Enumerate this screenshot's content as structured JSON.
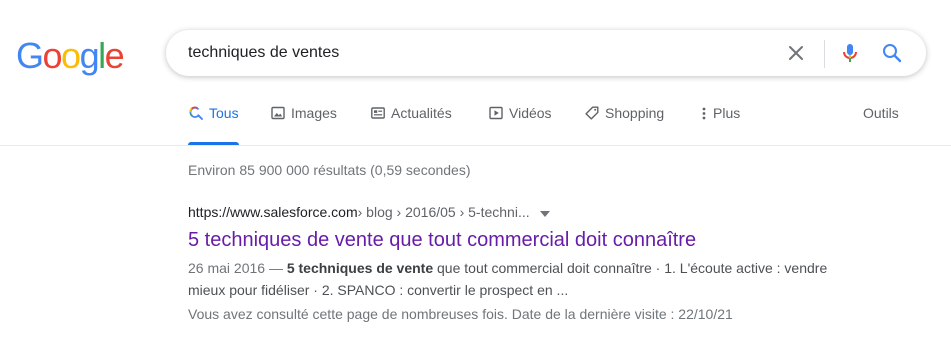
{
  "logo": {
    "letters": [
      "G",
      "o",
      "o",
      "g",
      "l",
      "e"
    ],
    "colors": [
      "#4285F4",
      "#EA4335",
      "#FBBC05",
      "#4285F4",
      "#34A853",
      "#EA4335"
    ]
  },
  "search": {
    "query": "techniques de ventes"
  },
  "tabs": [
    {
      "label": "Tous",
      "icon": "search-icon",
      "active": true
    },
    {
      "label": "Images",
      "icon": "image-icon"
    },
    {
      "label": "Actualités",
      "icon": "news-icon"
    },
    {
      "label": "Vidéos",
      "icon": "video-icon"
    },
    {
      "label": "Shopping",
      "icon": "tag-icon"
    },
    {
      "label": "Plus",
      "icon": "more-vertical-icon"
    }
  ],
  "tools_label": "Outils",
  "stats": "Environ 85 900 000 résultats (0,59 secondes)",
  "result": {
    "url_host": "https://www.salesforce.com",
    "url_crumbs": " › blog › 2016/05 › 5-techni...",
    "title": "5 techniques de vente que tout commercial doit connaître",
    "date": "26 mai 2016 — ",
    "snippet_bold": "5 techniques de vente",
    "snippet_rest": " que tout commercial doit connaître · 1. L'écoute active : vendre mieux pour fidéliser · 2. SPANCO : convertir le prospect en ...",
    "visited": "Vous avez consulté cette page de nombreuses fois. Date de la dernière visite : 22/10/21"
  },
  "colors": {
    "link_visited": "#681da8",
    "accent": "#1a73e8"
  }
}
